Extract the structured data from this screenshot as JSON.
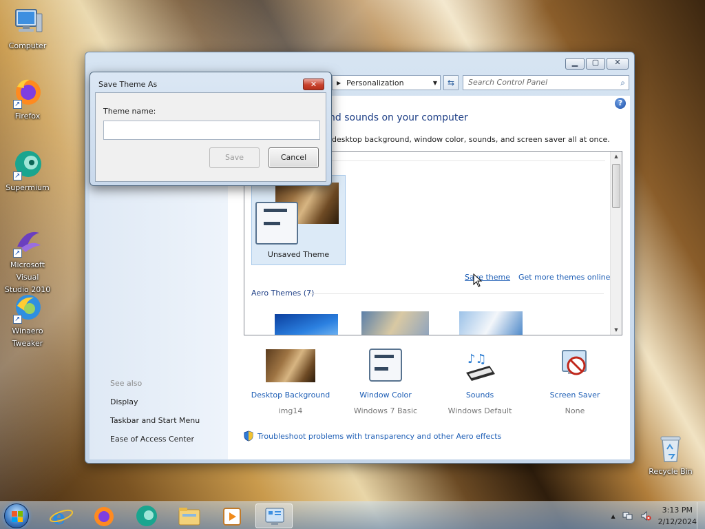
{
  "desktop": {
    "icons": [
      {
        "label": "Computer",
        "icon": "computer-icon"
      },
      {
        "label": "Firefox",
        "icon": "firefox-icon"
      },
      {
        "label": "Supermium",
        "icon": "supermium-icon"
      },
      {
        "label_line1": "Microsoft Visual",
        "label_line2": "Studio 2010",
        "icon": "visual-studio-icon"
      },
      {
        "label_line1": "Winaero",
        "label_line2": "Tweaker",
        "icon": "winaero-tweaker-icon"
      },
      {
        "label": "Recycle Bin",
        "icon": "recycle-bin-icon"
      }
    ]
  },
  "control_panel": {
    "address": "Personalization",
    "search_placeholder": "Search Control Panel",
    "heading": "nd sounds on your computer",
    "description": "desktop background, window color, sounds, and screen saver all at once.",
    "see_also": "See also",
    "left_links": [
      "Display",
      "Taskbar and Start Menu",
      "Ease of Access Center"
    ],
    "unsaved_theme": "Unsaved Theme",
    "save_theme": "Save theme",
    "get_more_themes": "Get more themes online",
    "aero_themes": "Aero Themes (7)",
    "bottom": [
      {
        "label": "Desktop Background",
        "sub": "img14"
      },
      {
        "label": "Window Color",
        "sub": "Windows 7 Basic"
      },
      {
        "label": "Sounds",
        "sub": "Windows Default"
      },
      {
        "label": "Screen Saver",
        "sub": "None"
      }
    ],
    "troubleshoot": "Troubleshoot problems with transparency and other Aero effects"
  },
  "dialog": {
    "title": "Save Theme As",
    "label": "Theme name:",
    "input_value": "",
    "save_button": "Save",
    "cancel_button": "Cancel"
  },
  "taskbar": {
    "time": "3:13 PM",
    "date": "2/12/2024"
  },
  "colors": {
    "link": "#1c5db5",
    "heading": "#1e3f86",
    "selected_tile": "#dceaf7"
  }
}
